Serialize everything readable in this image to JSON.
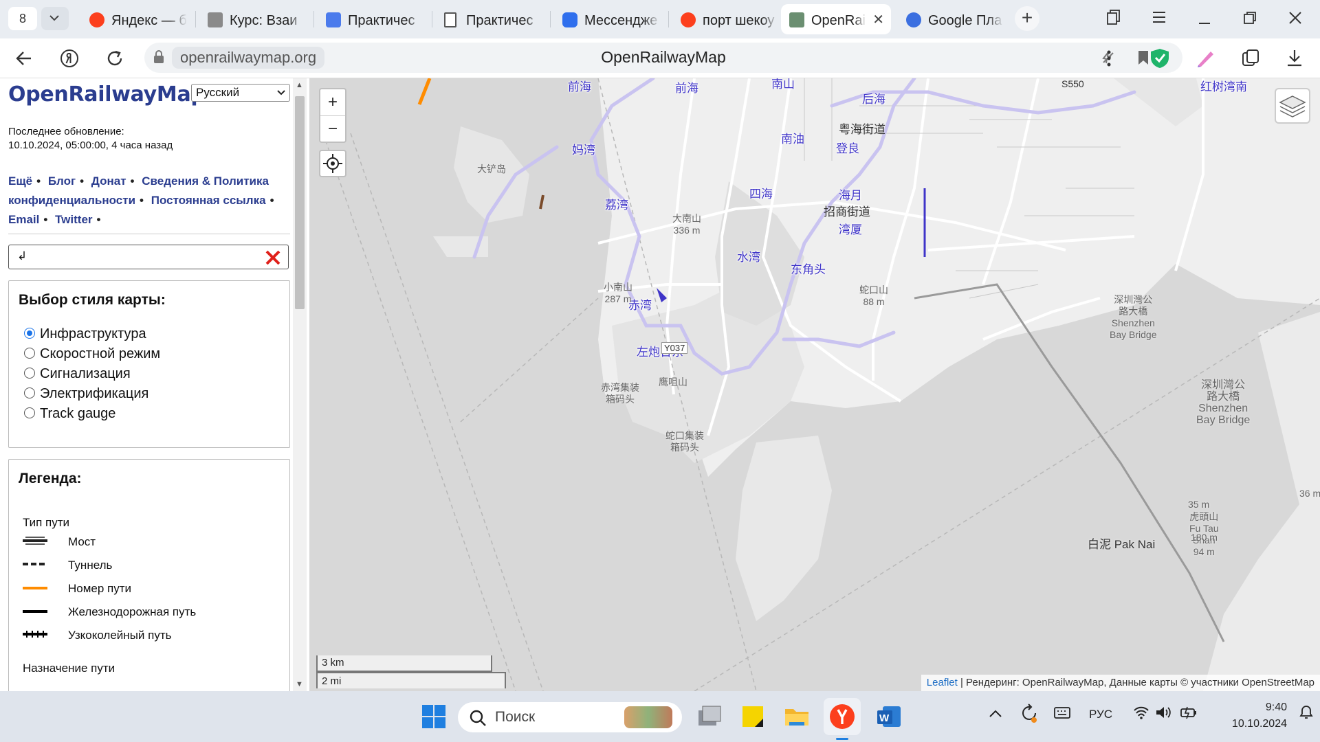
{
  "browser": {
    "tab_count": "8",
    "tabs": [
      {
        "title": "Яндекс — б",
        "favicon_color": "#fc3f1d",
        "active": false
      },
      {
        "title": "Курс: Взаи",
        "favicon_color": "#777777",
        "active": false
      },
      {
        "title": "Практичес",
        "favicon_color": "#4b7bec",
        "active": false
      },
      {
        "title": "Практичес",
        "favicon_color": "#555555",
        "active": false
      },
      {
        "title": "Мессендже",
        "favicon_color": "#2f6fed",
        "active": false
      },
      {
        "title": "порт шекоу",
        "favicon_color": "#fc3f1d",
        "active": false
      },
      {
        "title": "OpenRai",
        "favicon_color": "#6b8f71",
        "active": true
      },
      {
        "title": "Google Пла",
        "favicon_color": "#3b6fe0",
        "active": false
      }
    ],
    "url": "openrailwaymap.org",
    "page_title": "OpenRailwayMap"
  },
  "sidebar": {
    "site_title": "OpenRailwayMap",
    "language": "Русский",
    "updated_label": "Последнее обновление:",
    "updated_value": "10.10.2024, 05:00:00, 4 часа назад",
    "links": [
      "Ещё",
      "Блог",
      "Донат",
      "Сведения & Политика конфиденциальности",
      "Постоянная ссылка",
      "Email",
      "Twitter"
    ],
    "search_value": "↲",
    "style_panel": {
      "title": "Выбор стиля карты:",
      "options": [
        {
          "label": "Инфраструктура",
          "selected": true
        },
        {
          "label": "Скоростной режим",
          "selected": false
        },
        {
          "label": "Сигнализация",
          "selected": false
        },
        {
          "label": "Электрификация",
          "selected": false
        },
        {
          "label": "Track gauge",
          "selected": false
        }
      ]
    },
    "legend": {
      "title": "Легенда:",
      "section_track_type": "Тип пути",
      "items": [
        {
          "label": "Мост",
          "style": "bridge",
          "color": "#222222"
        },
        {
          "label": "Туннель",
          "style": "tunnel",
          "color": "#222222"
        },
        {
          "label": "Номер пути",
          "style": "solid",
          "color": "#ff8c00"
        },
        {
          "label": "Железнодорожная путь",
          "style": "solid",
          "color": "#000000"
        },
        {
          "label": "Узкоколейный путь",
          "style": "narrow",
          "color": "#000000"
        }
      ],
      "section_usage": "Назначение пути"
    }
  },
  "map": {
    "controls": {
      "zoom_in": "+",
      "zoom_out": "−",
      "locate_icon": "crosshair-icon",
      "layers_icon": "layers-icon"
    },
    "scale_km": "3 km",
    "scale_mi": "2 mi",
    "attribution_link": "Leaflet",
    "attribution_text": " | Рендеринг: OpenRailwayMap, Данные карты © участники OpenStreetMap",
    "station_labels": [
      "前海",
      "妈湾",
      "荔湾",
      "赤湾",
      "左炮台东",
      "南油",
      "登良",
      "四海",
      "海月",
      "湾厦",
      "水湾",
      "东角头",
      "后海",
      "红树湾南",
      "南山"
    ],
    "place_labels": [
      "大铲岛",
      "大南山\n336 m",
      "小南山\n287 m",
      "赤湾集装\n箱码头",
      "鹰咀山",
      "蛇口集装\n箱码头",
      "蛇口山\n88 m",
      "深圳灣公\n路大橋\nShenzhen\nBay Bridge",
      "深圳灣公\n路大橋\nShenzhen\nBay Bridge",
      "虎頭山\nFu Tau\nShan\n94 m",
      "35 m",
      "180 m",
      "36 m"
    ],
    "district_labels": [
      "招商街道",
      "粤海街道",
      "白泥 Pak Nai",
      "S550",
      "Y037"
    ],
    "colors": {
      "railway_station": "#3f34c8",
      "track_number": "#ff8c00",
      "water": "#d8d8d8",
      "land": "#efefef"
    }
  },
  "taskbar": {
    "search_placeholder": "Поиск",
    "language": "РУС",
    "time": "9:40",
    "date": "10.10.2024"
  }
}
